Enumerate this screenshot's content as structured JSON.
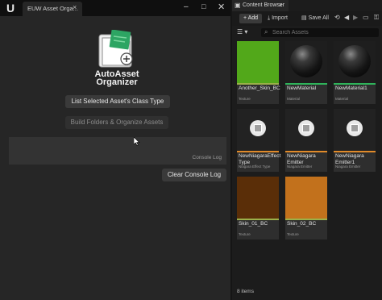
{
  "left_window": {
    "tab_label": "EUW Asset Orga...",
    "close": "×",
    "minimize": "–",
    "maximize": "□",
    "window_close": "✕",
    "app_title_line1": "AutoAsset",
    "app_title_line2": "Organizer",
    "list_button": "List Selected Asset's Class Type",
    "build_button": "Build Folders & Organize Assets",
    "console_label": "Console Log",
    "clear_button": "Clear Console Log"
  },
  "content_browser": {
    "tab_title": "Content Browser",
    "close": "×",
    "add_label": "+ Add",
    "import_label": "Import",
    "save_all_label": "Save All",
    "search_placeholder": "Search Assets",
    "item_count": "8 items",
    "assets": [
      {
        "name": "Another_Skin_BC",
        "type": "Texture",
        "thumb_color": "#52a81a",
        "stripe_color": "#9ab04a"
      },
      {
        "name": "NewMaterial",
        "type": "Material",
        "thumb_color": "#1e1e1e",
        "stripe_color": "#2fb35a"
      },
      {
        "name": "NewMaterial1",
        "type": "Material",
        "thumb_color": "#1e1e1e",
        "stripe_color": "#2fb35a"
      },
      {
        "name": "NewNiagaraEffect Type",
        "type": "Niagara Effect Type",
        "thumb_color": "#222222",
        "stripe_color": "#e08a2a"
      },
      {
        "name": "NewNiagara Emitter",
        "type": "Niagara Emitter",
        "thumb_color": "#222222",
        "stripe_color": "#e08a2a"
      },
      {
        "name": "NewNiagara Emitter1",
        "type": "Niagara Emitter",
        "thumb_color": "#222222",
        "stripe_color": "#e08a2a"
      },
      {
        "name": "Skin_01_BC",
        "type": "Texture",
        "thumb_color": "#5a2e08",
        "stripe_color": "#9ab04a"
      },
      {
        "name": "Skin_02_BC",
        "type": "Texture",
        "thumb_color": "#c2711c",
        "stripe_color": "#9ab04a"
      }
    ]
  }
}
